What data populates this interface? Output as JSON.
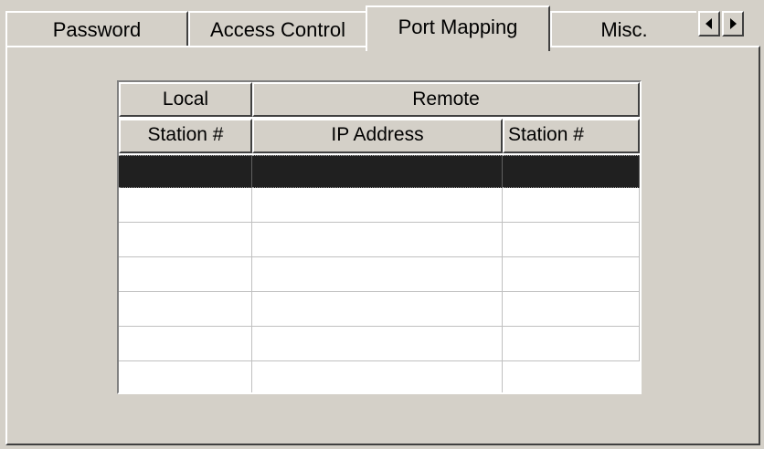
{
  "tabs": [
    {
      "label": "Password"
    },
    {
      "label": "Access Control"
    },
    {
      "label": "Port Mapping"
    },
    {
      "label": "Misc."
    }
  ],
  "active_tab": "Port Mapping",
  "nav": {
    "left_icon": "triangle-left-icon",
    "right_icon": "triangle-right-icon"
  },
  "grid": {
    "group_headers": [
      "Local",
      "Remote"
    ],
    "column_headers": [
      "Station #",
      "IP Address",
      "Station #"
    ],
    "rows": [
      [
        "",
        "",
        ""
      ],
      [
        "",
        "",
        ""
      ],
      [
        "",
        "",
        ""
      ],
      [
        "",
        "",
        ""
      ],
      [
        "",
        "",
        ""
      ],
      [
        "",
        "",
        ""
      ],
      [
        "",
        "",
        ""
      ]
    ],
    "selected_row": 0
  },
  "colors": {
    "face": "#d4d0c8",
    "selection": "#202020"
  }
}
